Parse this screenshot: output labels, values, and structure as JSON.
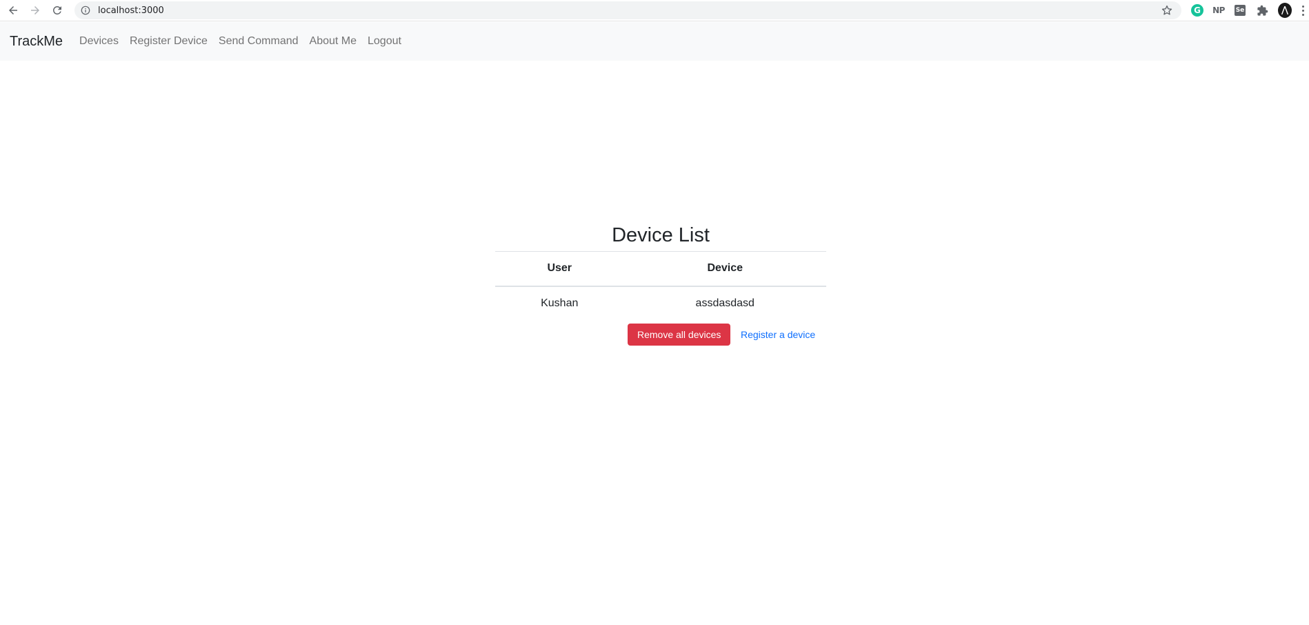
{
  "browser": {
    "url": "localhost:3000",
    "extensions": [
      "grammarly-icon",
      "np-icon",
      "se-icon",
      "puzzle-icon",
      "profile-avatar"
    ],
    "np_label": "NP",
    "se_label": "Se",
    "g_label": "G"
  },
  "navbar": {
    "brand": "TrackMe",
    "links": [
      {
        "label": "Devices"
      },
      {
        "label": "Register Device"
      },
      {
        "label": "Send Command"
      },
      {
        "label": "About Me"
      },
      {
        "label": "Logout"
      }
    ]
  },
  "main": {
    "title": "Device List",
    "columns": [
      "User",
      "Device"
    ],
    "rows": [
      {
        "user": "Kushan",
        "device": "assdasdasd"
      }
    ],
    "remove_button": "Remove all devices",
    "register_link": "Register a device"
  },
  "colors": {
    "danger": "#dc3545",
    "link": "#0d6efd",
    "navbar_bg": "#f8f9fa"
  }
}
